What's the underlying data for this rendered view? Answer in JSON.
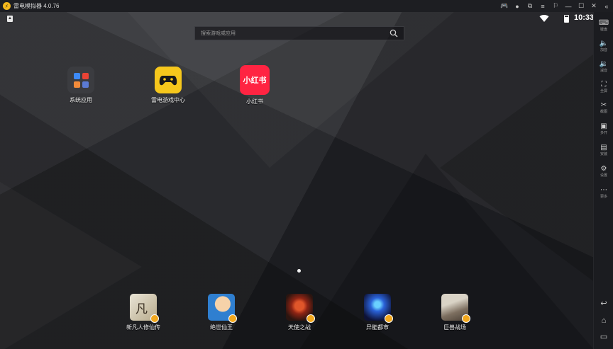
{
  "window": {
    "title": "雷电模拟器 4.0.76",
    "logo_glyph": "⚡",
    "controls": [
      "🎮",
      "●",
      "⧉",
      "≡",
      "⚐",
      "—",
      "☐",
      "✕",
      "«"
    ]
  },
  "statusbar": {
    "time": "10:33",
    "notif_glyph": "▲"
  },
  "search": {
    "placeholder": "搜索游戏或应用"
  },
  "desktop_apps": [
    {
      "label": "系统应用",
      "icon": "system-apps-folder-icon"
    },
    {
      "label": "雷电游戏中心",
      "icon": "gamepad-icon"
    },
    {
      "label": "小红书",
      "icon": "xiaohongshu-icon",
      "icon_text": "小红书"
    }
  ],
  "dock_apps": [
    {
      "label": "新凡人修仙传",
      "colors": [
        "#e9e4d6",
        "#b8ab8c"
      ],
      "glyph": "凡"
    },
    {
      "label": "绝世仙王",
      "colors": [
        "#f2c79a",
        "#2f7fd0"
      ],
      "glyph": ""
    },
    {
      "label": "天使之战",
      "colors": [
        "#c03b1e",
        "#2b1510"
      ],
      "glyph": ""
    },
    {
      "label": "异能都市",
      "colors": [
        "#2a62d8",
        "#0e1236"
      ],
      "glyph": ""
    },
    {
      "label": "巨兽战场",
      "colors": [
        "#b9b2a4",
        "#5c5247"
      ],
      "glyph": ""
    }
  ],
  "toolbar": {
    "items": [
      {
        "glyph": "⌨",
        "label": "键盘"
      },
      {
        "glyph": "🔈",
        "label": "加音"
      },
      {
        "glyph": "🔉",
        "label": "减音"
      },
      {
        "glyph": "⛶",
        "label": "全屏"
      },
      {
        "glyph": "✂",
        "label": "截图"
      },
      {
        "glyph": "▣",
        "label": "多开"
      },
      {
        "glyph": "▤",
        "label": "安装"
      },
      {
        "glyph": "⚙",
        "label": "设置"
      },
      {
        "glyph": "⋯",
        "label": "更多"
      }
    ],
    "nav": [
      "↩",
      "⌂",
      "▭"
    ]
  }
}
